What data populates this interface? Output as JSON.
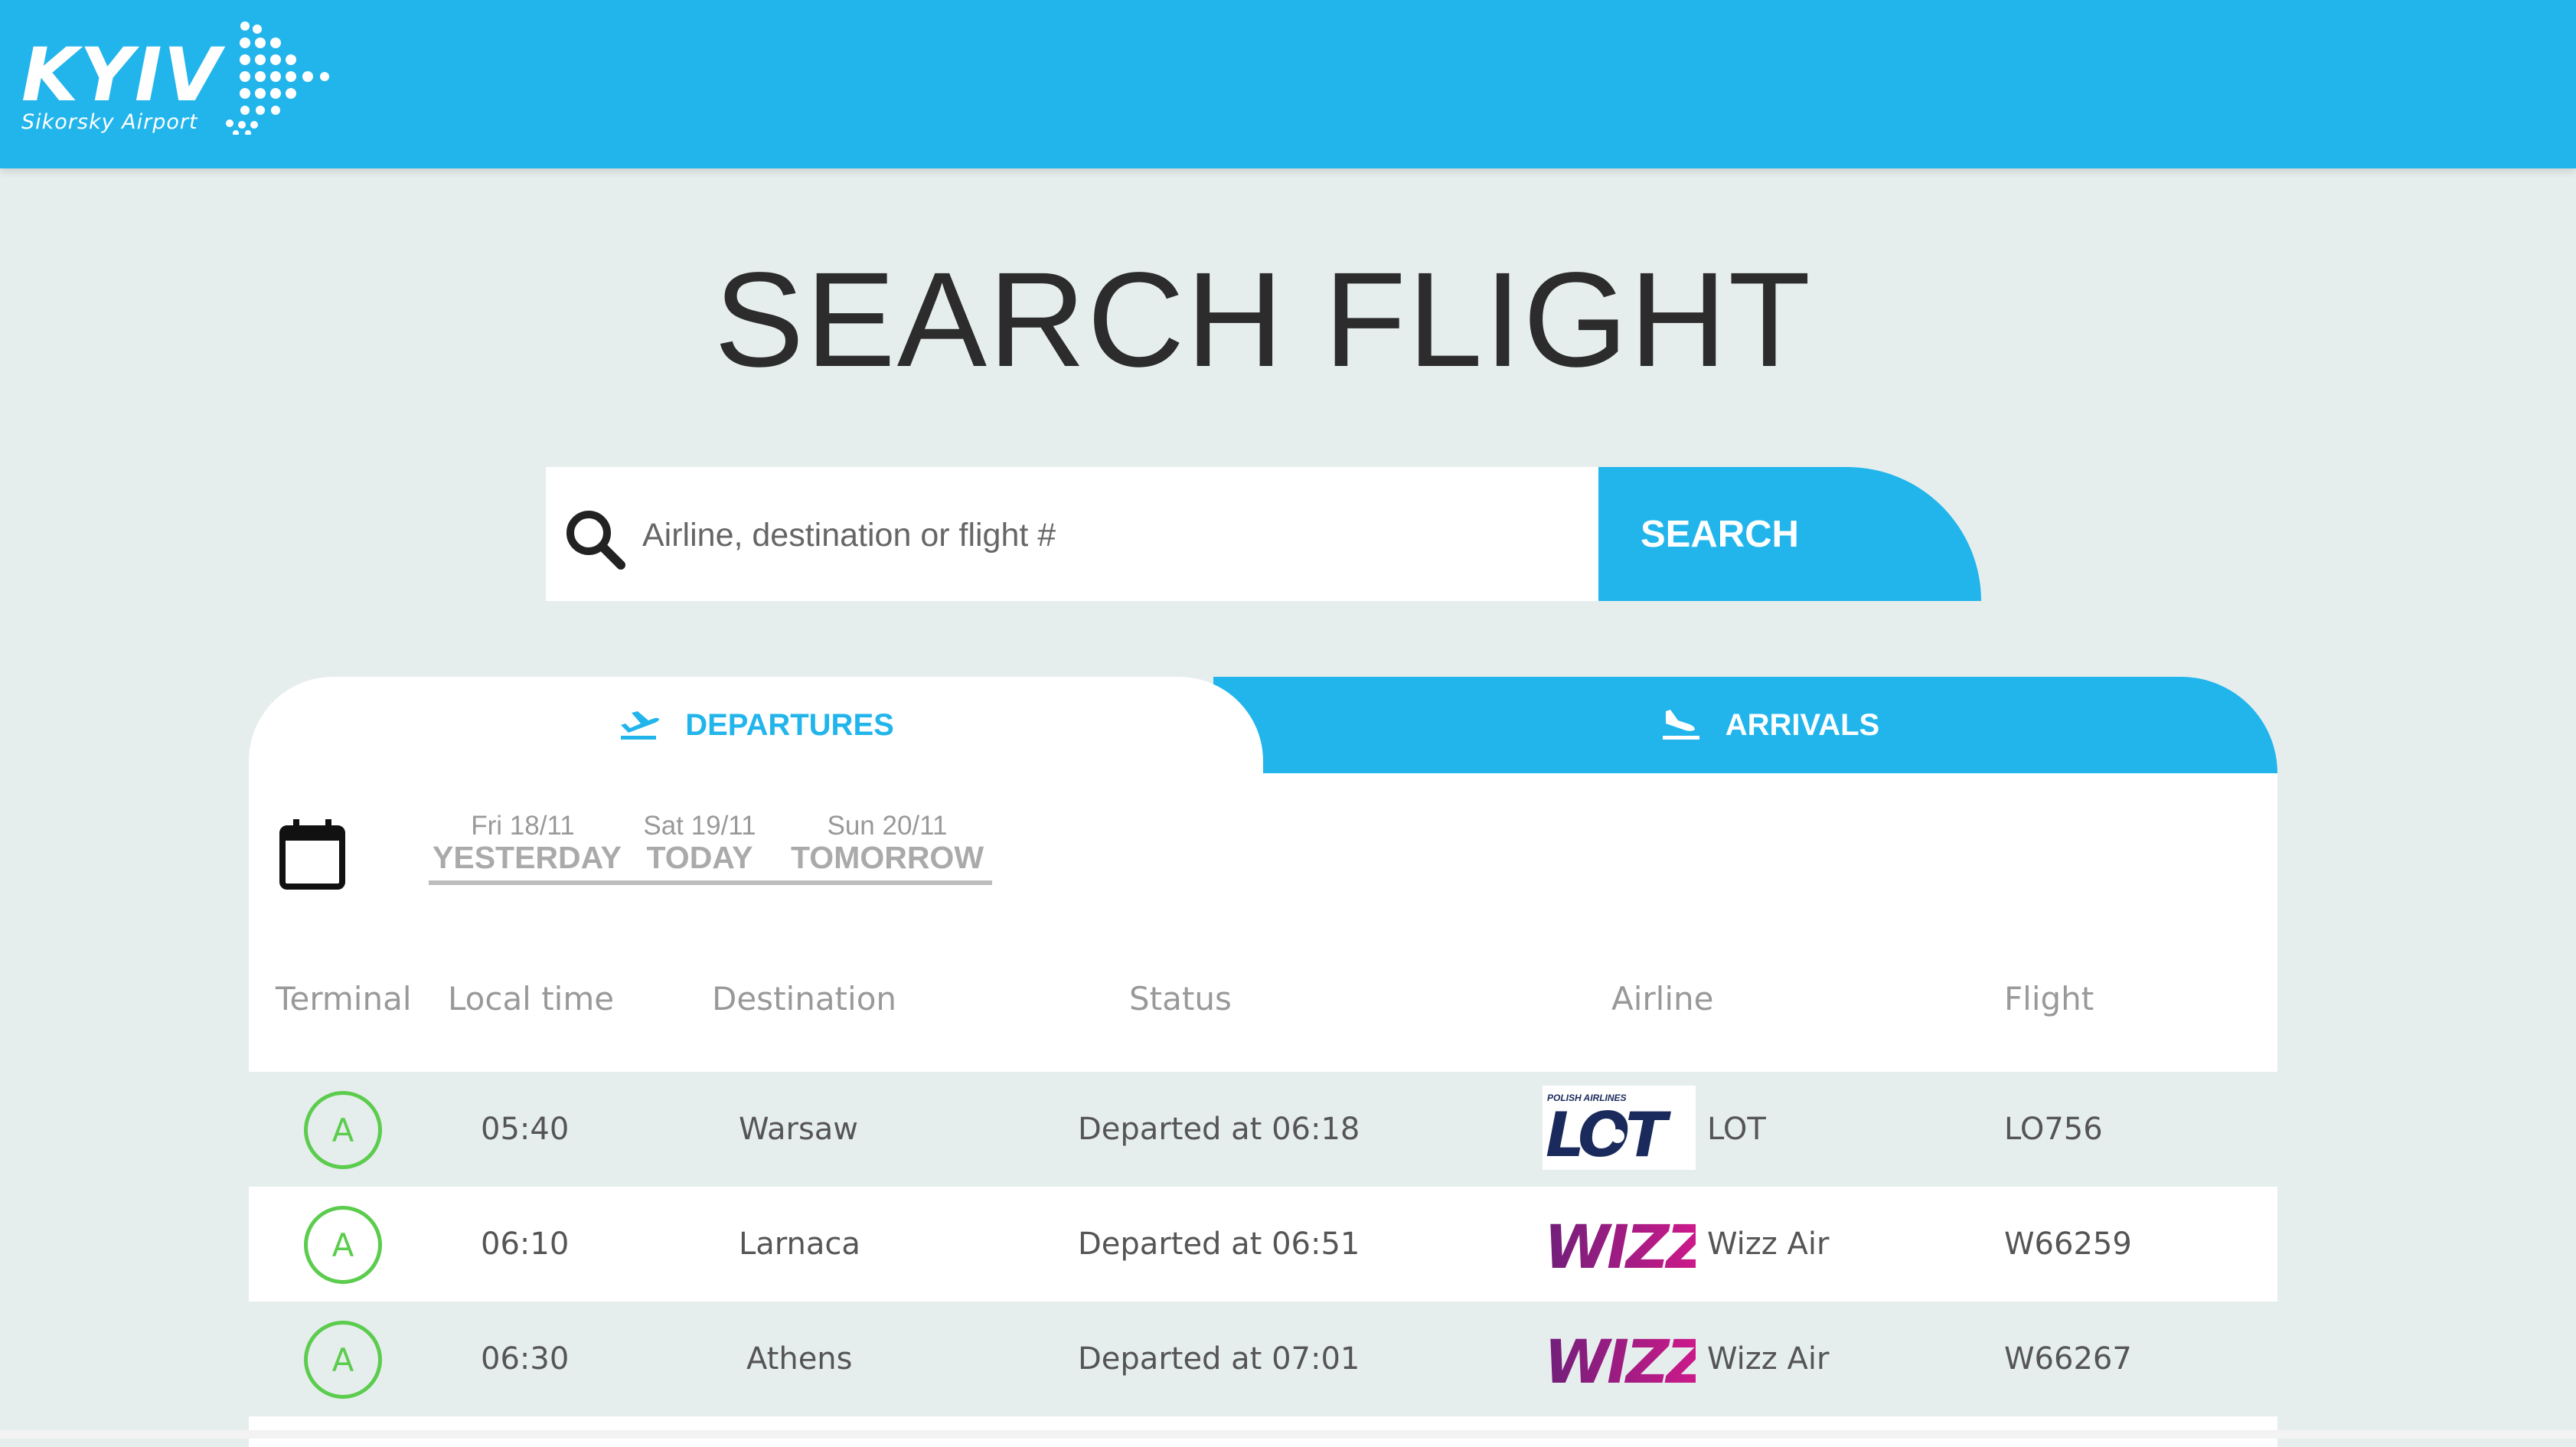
{
  "brand": {
    "logo_word": "KYIV",
    "logo_sub": "Sikorsky Airport",
    "accent_color": "#22b5ec"
  },
  "page_title": "SEARCH FLIGHT",
  "search": {
    "placeholder": "Airline, destination or flight #",
    "value": "",
    "button_label": "SEARCH",
    "icon": "search-icon"
  },
  "tabs": [
    {
      "label": "DEPARTURES",
      "icon": "plane-takeoff-icon",
      "active": true
    },
    {
      "label": "ARRIVALS",
      "icon": "plane-landing-icon",
      "active": false
    }
  ],
  "date_selector": {
    "icon": "calendar-icon",
    "days": [
      {
        "date": "Fri 18/11",
        "label": "YESTERDAY"
      },
      {
        "date": "Sat 19/11",
        "label": "TODAY"
      },
      {
        "date": "Sun 20/11",
        "label": "TOMORROW"
      }
    ]
  },
  "table": {
    "columns": [
      "Terminal",
      "Local time",
      "Destination",
      "Status",
      "Airline",
      "Flight"
    ],
    "rows": [
      {
        "terminal": "A",
        "time": "05:40",
        "destination": "Warsaw",
        "status": "Departed at 06:18",
        "airline": "LOT",
        "airline_logo": "lot-logo",
        "logo_text": "LOT",
        "logo_caption": "POLISH AIRLINES",
        "flight": "LO756"
      },
      {
        "terminal": "A",
        "time": "06:10",
        "destination": "Larnaca",
        "status": "Departed at 06:51",
        "airline": "Wizz Air",
        "airline_logo": "wizz-logo",
        "logo_text": "WIZZ",
        "flight": "W66259"
      },
      {
        "terminal": "A",
        "time": "06:30",
        "destination": "Athens",
        "status": "Departed at 07:01",
        "airline": "Wizz Air",
        "airline_logo": "wizz-logo",
        "logo_text": "WIZZ",
        "flight": "W66267"
      }
    ]
  },
  "colors": {
    "header_bg": "#22b5ec",
    "page_bg": "#e6eeed",
    "terminal_green": "#5ccc4e",
    "lot_navy": "#1b2a5c",
    "wizz_purple": "#6f1f7a",
    "wizz_pink": "#d6198c"
  }
}
